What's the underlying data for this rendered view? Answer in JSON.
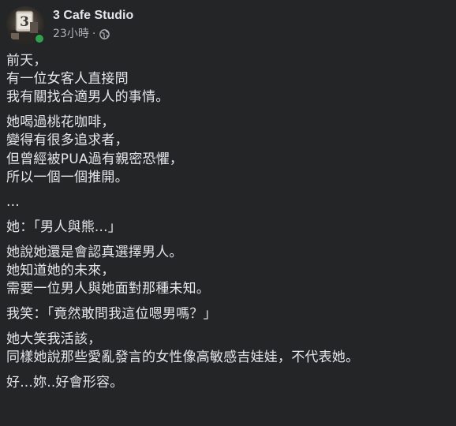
{
  "post": {
    "author": "3 Cafe Studio",
    "avatar_text": "3",
    "timestamp": "23小時",
    "separator": "·",
    "privacy_icon": "globe-icon",
    "online_status_color": "#31a24c"
  },
  "body": {
    "paragraphs": [
      [
        "前天，",
        "有一位女客人直接問",
        "我有關找合適男人的事情。"
      ],
      [
        "她喝過桃花咖啡，",
        "變得有很多追求者，",
        "但曾經被PUA過有親密恐懼，",
        "所以一個一個推開。"
      ],
      [
        "..."
      ],
      [
        "她：「男人與熊...」"
      ],
      [
        "她說她還是會認真選擇男人。",
        "她知道她的未來，",
        "需要一位男人與她面對那種未知。"
      ],
      [
        "我笑：「竟然敢問我這位嗯男嗎？」"
      ],
      [
        "她大笑我活該，",
        "同樣她說那些愛亂發言的女性像高敏感吉娃娃，不代表她。"
      ],
      [
        "好...妳..好會形容。"
      ]
    ]
  }
}
